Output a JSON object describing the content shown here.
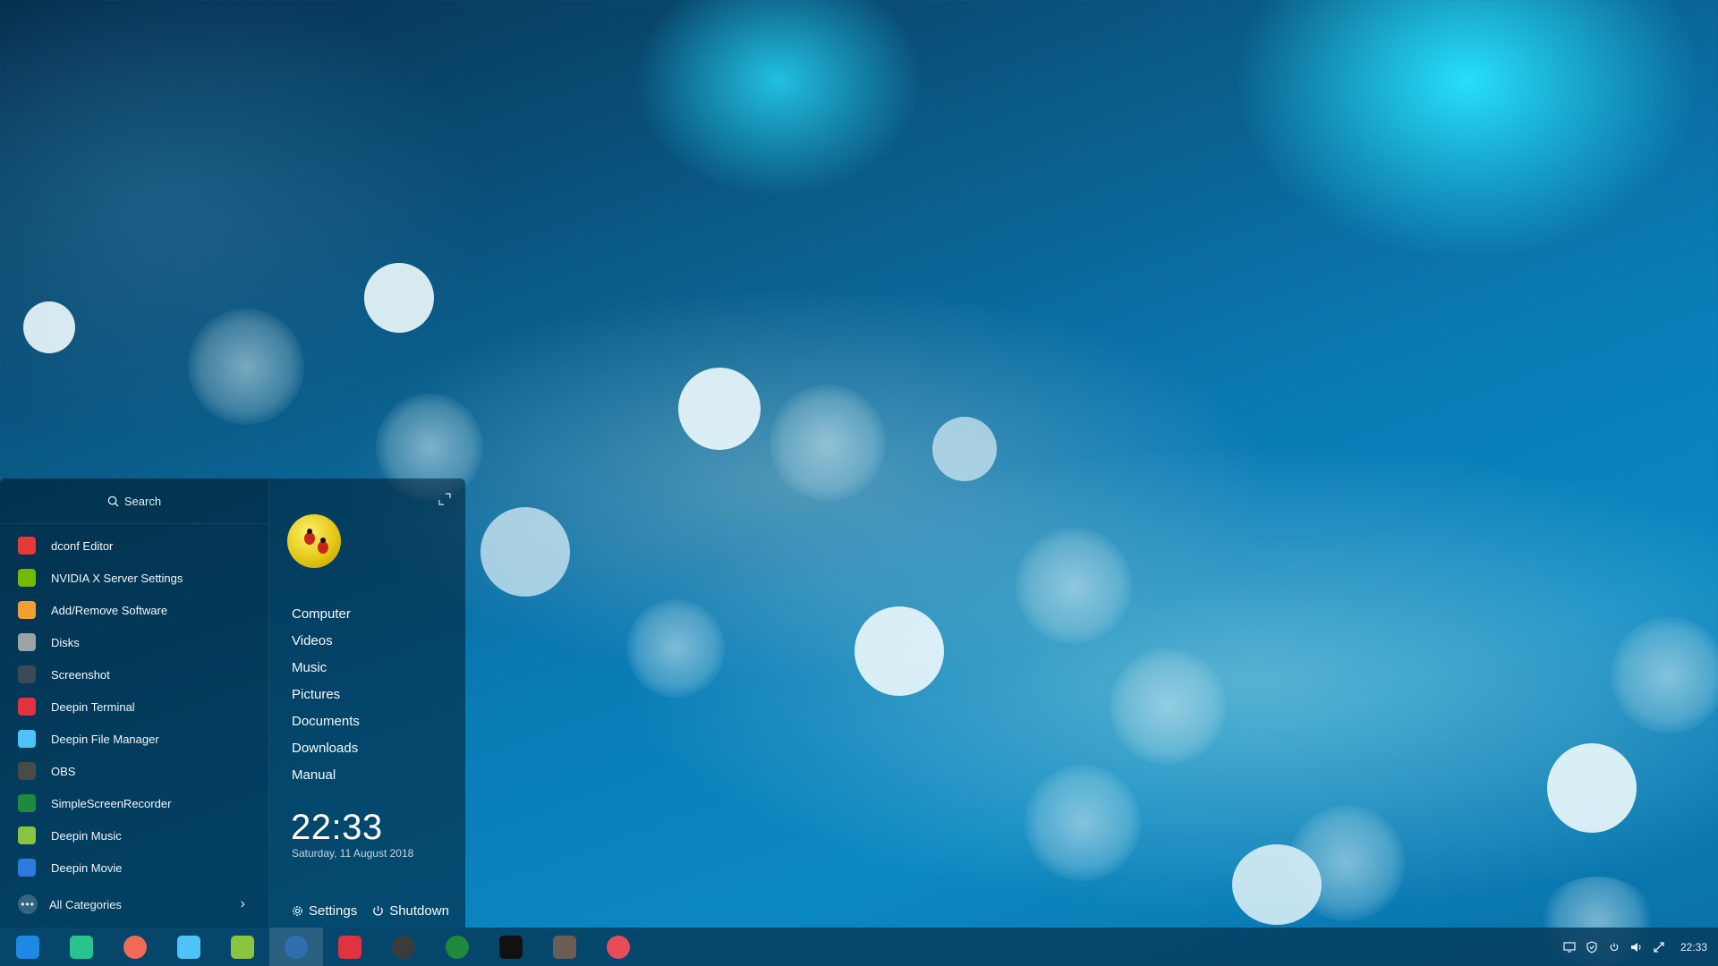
{
  "launcher": {
    "search": {
      "label": "Search"
    },
    "apps": [
      {
        "label": "dconf Editor",
        "icon": "dconf-editor-icon",
        "color": "#e53935"
      },
      {
        "label": "NVIDIA X Server Settings",
        "icon": "nvidia-icon",
        "color": "#76b900"
      },
      {
        "label": "Add/Remove Software",
        "icon": "package-icon",
        "color": "#f0a030"
      },
      {
        "label": "Disks",
        "icon": "disks-icon",
        "color": "#9aa3a8"
      },
      {
        "label": "Screenshot",
        "icon": "screenshot-icon",
        "color": "#3a4a58"
      },
      {
        "label": "Deepin Terminal",
        "icon": "terminal-icon",
        "color": "#e0323f"
      },
      {
        "label": "Deepin File Manager",
        "icon": "file-manager-icon",
        "color": "#4ec3f7"
      },
      {
        "label": "OBS",
        "icon": "obs-icon",
        "color": "#4a4a4a"
      },
      {
        "label": "SimpleScreenRecorder",
        "icon": "screen-recorder-icon",
        "color": "#1e8a3c"
      },
      {
        "label": "Deepin Music",
        "icon": "music-icon",
        "color": "#8bc53f"
      },
      {
        "label": "Deepin Movie",
        "icon": "movie-icon",
        "color": "#2d7be0"
      }
    ],
    "all_categories": "All Categories",
    "places": [
      "Computer",
      "Videos",
      "Music",
      "Pictures",
      "Documents",
      "Downloads",
      "Manual"
    ],
    "clock": "22:33",
    "date": "Saturday, 11 August 2018",
    "settings_label": "Settings",
    "shutdown_label": "Shutdown"
  },
  "taskbar": {
    "items": [
      {
        "name": "launcher-icon",
        "color": "#1e88e5",
        "active": false
      },
      {
        "name": "terminal-green-icon",
        "color": "#27c48e",
        "active": false
      },
      {
        "name": "screen-recorder-icon",
        "color": "#f06a55",
        "active": false
      },
      {
        "name": "file-manager-icon",
        "color": "#4ec3f7",
        "active": false
      },
      {
        "name": "music-icon",
        "color": "#8bc53f",
        "active": false
      },
      {
        "name": "deepin-browser-icon",
        "color": "#2f6fb0",
        "active": true
      },
      {
        "name": "terminal-icon",
        "color": "#e0323f",
        "active": false
      },
      {
        "name": "obs-icon",
        "color": "#3b3b3b",
        "active": false
      },
      {
        "name": "simple-screen-recorder-icon",
        "color": "#1e8a3c",
        "active": false
      },
      {
        "name": "inkscape-icon",
        "color": "#111111",
        "active": false
      },
      {
        "name": "gimp-icon",
        "color": "#6b5d54",
        "active": false
      },
      {
        "name": "settings-gear-icon",
        "color": "#e94b5a",
        "active": false
      }
    ],
    "tray": [
      "display-icon",
      "shield-icon",
      "power-icon",
      "volume-icon",
      "network-icon"
    ],
    "clock": "22:33"
  }
}
